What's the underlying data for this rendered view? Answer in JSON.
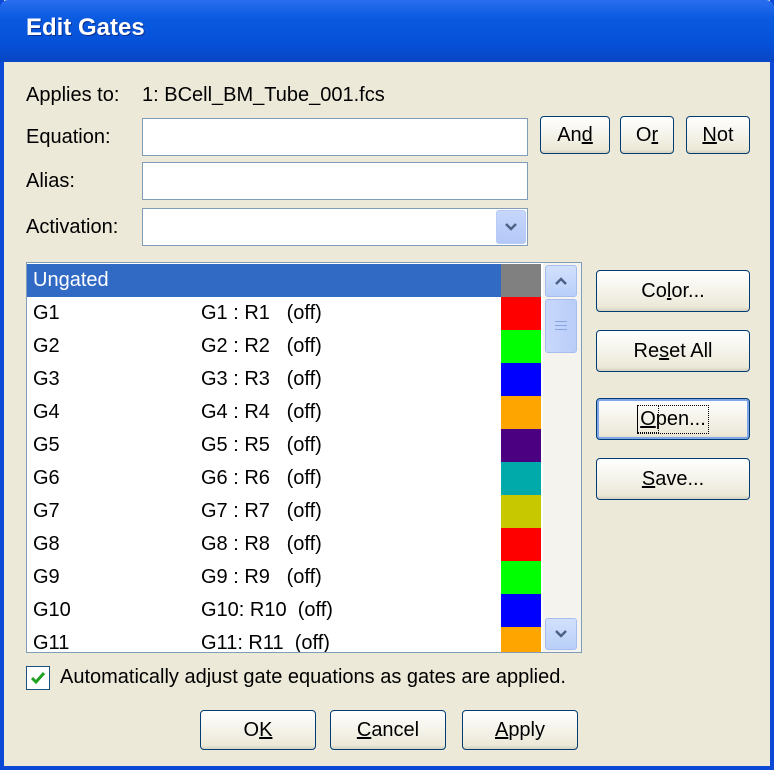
{
  "window": {
    "title": "Edit Gates"
  },
  "applies_to": {
    "label": "Applies to:",
    "value": "1: BCell_BM_Tube_001.fcs"
  },
  "equation": {
    "label": "Equation:",
    "value": ""
  },
  "alias": {
    "label": "Alias:",
    "value": ""
  },
  "activation": {
    "label": "Activation:",
    "value": ""
  },
  "ops": {
    "and": "And",
    "or": "Or",
    "not": "Not"
  },
  "side": {
    "color": "Color...",
    "reset": "Reset All",
    "open": "Open...",
    "save": "Save..."
  },
  "gates": [
    {
      "name": "Ungated",
      "eq": "",
      "color": "#808080",
      "selected": true
    },
    {
      "name": "G1",
      "eq": "G1 : R1   (off)",
      "color": "#ff0000"
    },
    {
      "name": "G2",
      "eq": "G2 : R2   (off)",
      "color": "#00ff00"
    },
    {
      "name": "G3",
      "eq": "G3 : R3   (off)",
      "color": "#0000ff"
    },
    {
      "name": "G4",
      "eq": "G4 : R4   (off)",
      "color": "#ffa500"
    },
    {
      "name": "G5",
      "eq": "G5 : R5   (off)",
      "color": "#4b0082"
    },
    {
      "name": "G6",
      "eq": "G6 : R6   (off)",
      "color": "#00aaaa"
    },
    {
      "name": "G7",
      "eq": "G7 : R7   (off)",
      "color": "#c8c800"
    },
    {
      "name": "G8",
      "eq": "G8 : R8   (off)",
      "color": "#ff0000"
    },
    {
      "name": "G9",
      "eq": "G9 : R9   (off)",
      "color": "#00ff00"
    },
    {
      "name": "G10",
      "eq": "G10: R10  (off)",
      "color": "#0000ff"
    },
    {
      "name": "G11",
      "eq": "G11: R11  (off)",
      "color": "#ffa500"
    }
  ],
  "auto_adjust": {
    "label": "Automatically adjust gate equations as gates are applied.",
    "checked": true
  },
  "footer": {
    "ok": "OK",
    "cancel": "Cancel",
    "apply": "Apply"
  }
}
